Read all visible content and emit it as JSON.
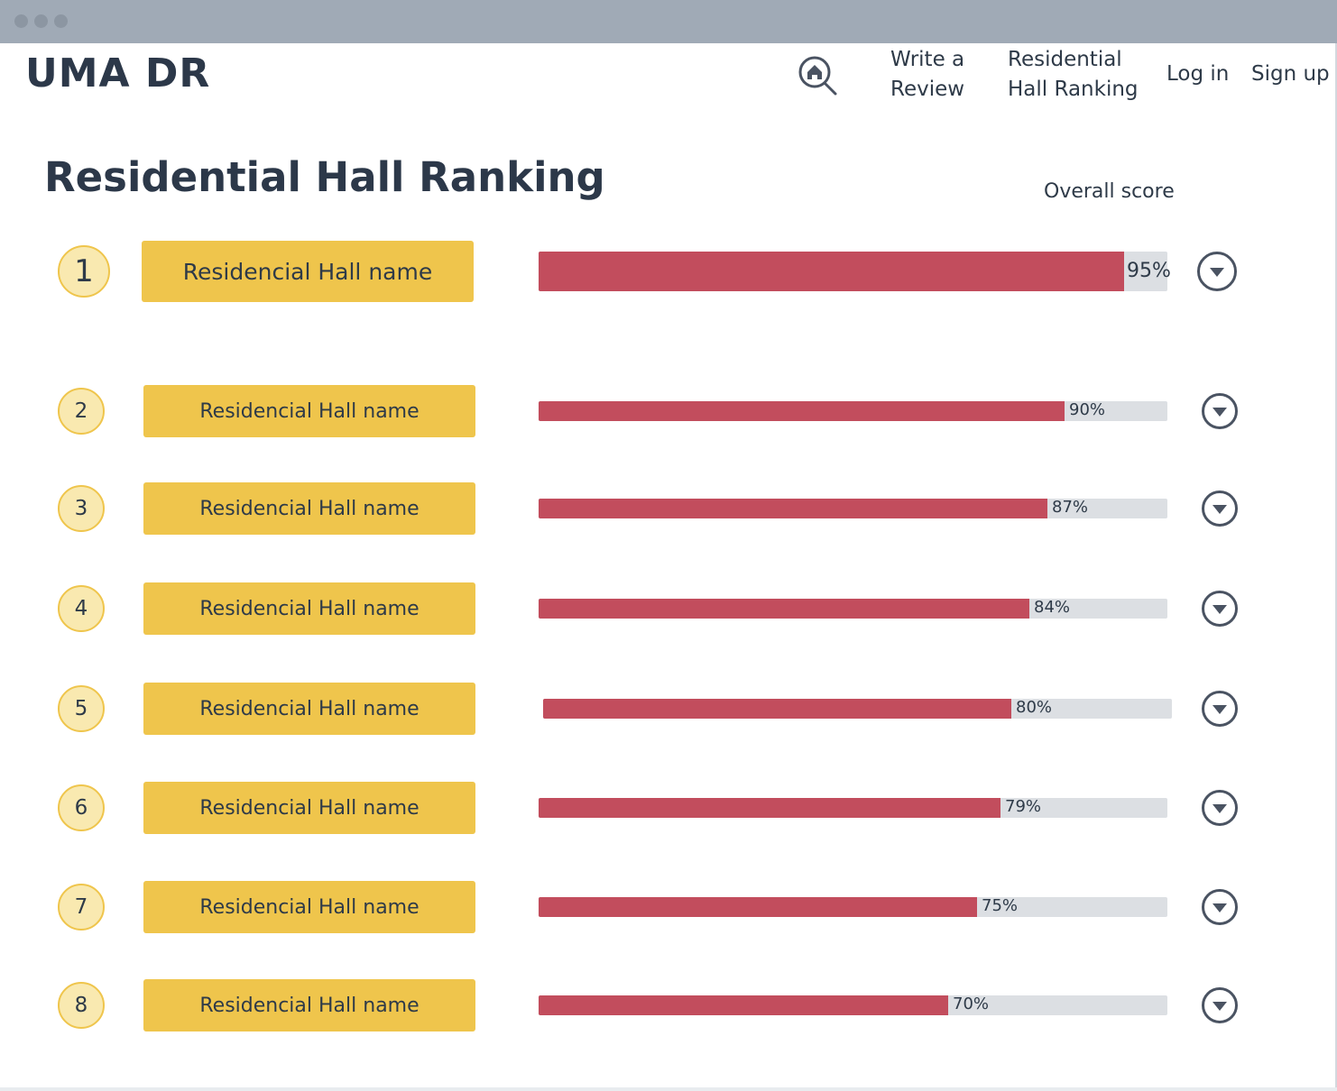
{
  "colors": {
    "accent_yellow": "#efc54c",
    "rank_circle_fill": "#f9e9b0",
    "bar_fill": "#c24d5d",
    "bar_track": "#dcdfe3",
    "text_dark": "#2c3849",
    "window_bar": "#a0aab6"
  },
  "header": {
    "logo": "UMA DR",
    "search_icon": "home-search-icon",
    "nav": {
      "write_review": [
        "Write a",
        "Review"
      ],
      "hall_ranking": [
        "Residential",
        "Hall Ranking"
      ],
      "log_in": "Log in",
      "sign_up": "Sign up"
    }
  },
  "main": {
    "title": "Residential Hall Ranking",
    "score_column_label": "Overall score",
    "expand_icon": "chevron-down-circle-icon",
    "rankings": [
      {
        "rank": "1",
        "name": "Residencial Hall name",
        "score": 95,
        "score_label": "95%"
      },
      {
        "rank": "2",
        "name": "Residencial Hall name",
        "score": 90,
        "score_label": "90%"
      },
      {
        "rank": "3",
        "name": "Residencial Hall name",
        "score": 87,
        "score_label": "87%"
      },
      {
        "rank": "4",
        "name": "Residencial Hall name",
        "score": 84,
        "score_label": "84%"
      },
      {
        "rank": "5",
        "name": "Residencial Hall name",
        "score": 80,
        "score_label": "80%"
      },
      {
        "rank": "6",
        "name": "Residencial Hall name",
        "score": 79,
        "score_label": "79%"
      },
      {
        "rank": "7",
        "name": "Residencial Hall name",
        "score": 75,
        "score_label": "75%"
      },
      {
        "rank": "8",
        "name": "Residencial Hall name",
        "score": 70,
        "score_label": "70%"
      }
    ]
  }
}
